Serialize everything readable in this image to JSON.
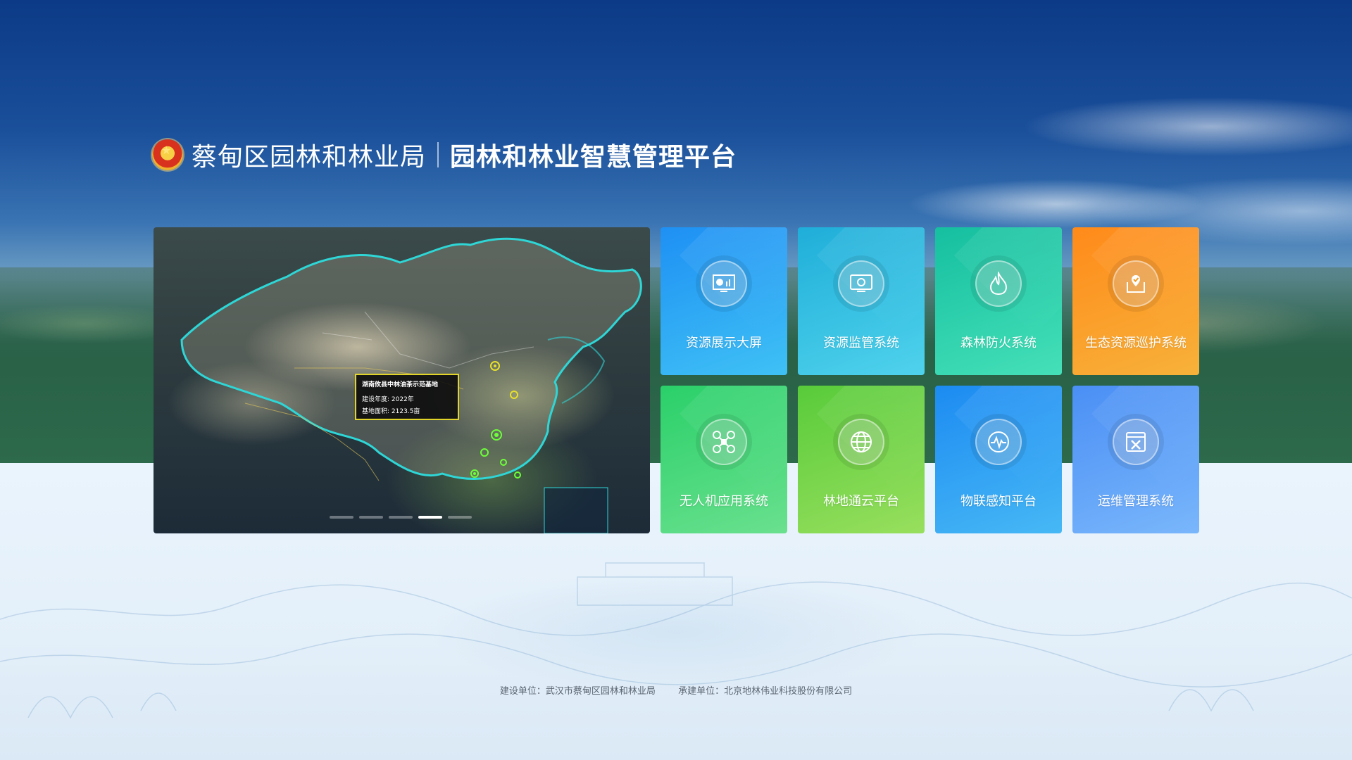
{
  "header": {
    "org_name": "蔡甸区园林和林业局",
    "platform_name": "园林和林业智慧管理平台",
    "emblem_icon": "national-emblem-icon"
  },
  "map_card": {
    "tooltip": {
      "title": "湖南攸县中林油茶示范基地",
      "year": "建设年度: 2022年",
      "area": "基地面积: 2123.5亩"
    },
    "slides_total": 5,
    "active_slide": 4
  },
  "tiles": [
    {
      "label": "资源展示大屏",
      "icon": "dashboard-screen-icon"
    },
    {
      "label": "资源监管系统",
      "icon": "monitor-icon"
    },
    {
      "label": "森林防火系统",
      "icon": "flame-icon"
    },
    {
      "label": "生态资源巡护系统",
      "icon": "patrol-shield-icon"
    },
    {
      "label": "无人机应用系统",
      "icon": "drone-icon"
    },
    {
      "label": "林地通云平台",
      "icon": "globe-icon"
    },
    {
      "label": "物联感知平台",
      "icon": "pulse-sensor-icon"
    },
    {
      "label": "运维管理系统",
      "icon": "tools-icon"
    }
  ],
  "footer": {
    "builder": "建设单位：武汉市蔡甸区园林和林业局",
    "contractor": "承建单位：北京地林伟业科技股份有限公司"
  }
}
